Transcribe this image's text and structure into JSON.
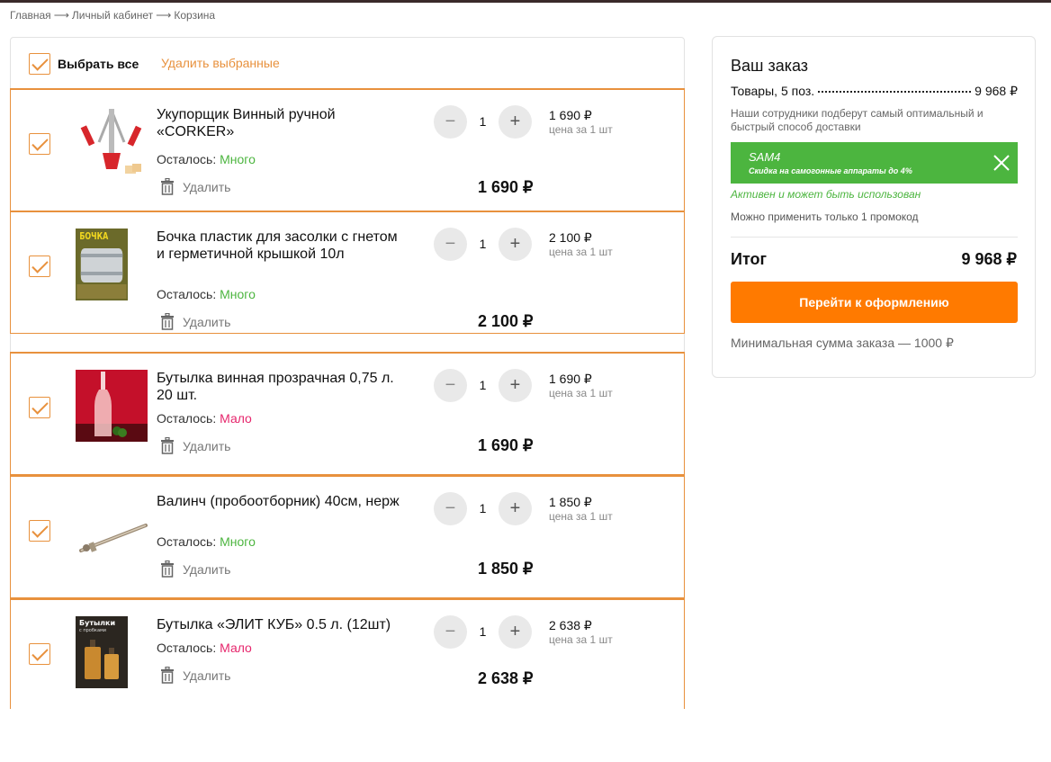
{
  "breadcrumb": [
    "Главная",
    "Личный кабинет",
    "Корзина"
  ],
  "breadcrumb_sep": "⟶",
  "cart": {
    "select_all": "Выбрать все",
    "delete_selected": "Удалить выбранные",
    "delete_label": "Удалить",
    "stock_label": "Осталось:",
    "unit_note": "цена за 1 шт",
    "items": [
      {
        "title": "Укупорщик Винный ручной «CORKER»",
        "stock": "Много",
        "qty": "1",
        "unit_price": "1 690 ₽",
        "total": "1 690 ₽"
      },
      {
        "title": "Бочка пластик для засолки с гнетом и герметичной крышкой 10л",
        "stock": "Много",
        "qty": "1",
        "unit_price": "2 100 ₽",
        "total": "2 100 ₽"
      },
      {
        "title": "Бутылка винная прозрачная 0,75 л. 20 шт.",
        "stock": "Мало",
        "qty": "1",
        "unit_price": "1 690 ₽",
        "total": "1 690 ₽"
      },
      {
        "title": "Валинч (пробоотборник) 40см, нерж",
        "stock": "Много",
        "qty": "1",
        "unit_price": "1 850 ₽",
        "total": "1 850 ₽"
      },
      {
        "title": "Бутылка «ЭЛИТ КУБ» 0.5 л. (12шт)",
        "stock": "Мало",
        "qty": "1",
        "unit_price": "2 638 ₽",
        "total": "2 638 ₽"
      }
    ],
    "thumb_texts": {
      "barrel": "БОЧКА",
      "box_title": "Бутылки",
      "box_sub": "с пробками"
    }
  },
  "order": {
    "title": "Ваш заказ",
    "goods_label": "Товары, 5 поз.",
    "goods_total": "9 968 ₽",
    "delivery_note": "Наши сотрудники подберут самый оптимальный и быстрый способ доставки",
    "promo_code": "SAM4",
    "promo_desc": "Скидка на самогонные аппараты до 4%",
    "promo_status": "Активен и может быть использован",
    "promo_limit": "Можно применить только 1 промокод",
    "total_label": "Итог",
    "total_value": "9 968 ₽",
    "checkout_label": "Перейти к оформлению",
    "min_sum": "Минимальная сумма заказа — 1000 ₽"
  },
  "colors": {
    "accent": "#e8913d",
    "green": "#4cb53f",
    "pink": "#e6266c",
    "checkout": "#ff7a00"
  },
  "icons": [
    "check-icon",
    "minus-icon",
    "plus-icon",
    "trash-icon",
    "close-icon"
  ]
}
